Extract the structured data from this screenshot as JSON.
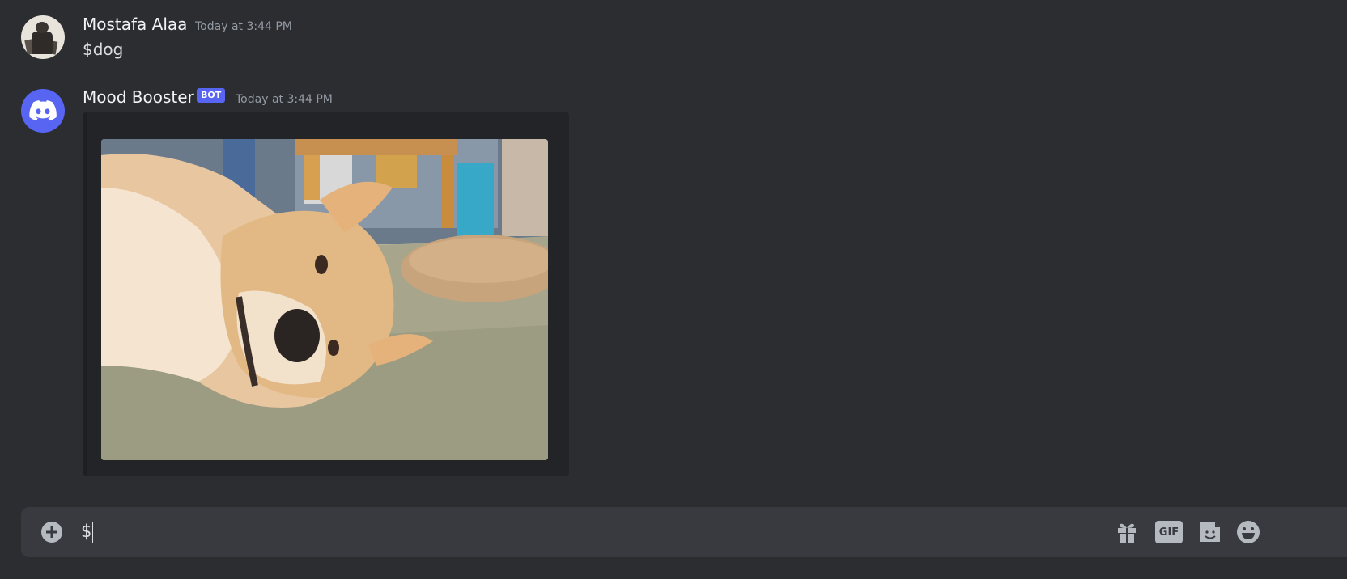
{
  "messages": [
    {
      "author": "Mostafa Alaa",
      "timestamp": "Today at 3:44 PM",
      "text": "$dog"
    },
    {
      "author": "Mood Booster",
      "badge": "BOT",
      "timestamp": "Today at 3:44 PM",
      "embed_image": "shiba-inu-dog-lying-on-carpet"
    }
  ],
  "composer": {
    "value": "$",
    "icons": [
      "plus-circle-icon",
      "gift-icon",
      "gif-icon",
      "sticker-icon",
      "emoji-icon"
    ],
    "gif_label": "GIF"
  },
  "colors": {
    "background": "#2b2d31",
    "composer": "#383a40",
    "brand": "#5865f2",
    "embed": "#232428"
  }
}
